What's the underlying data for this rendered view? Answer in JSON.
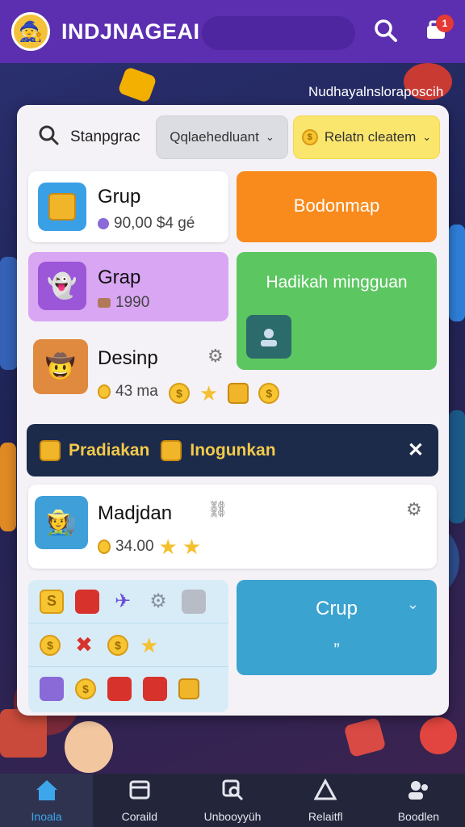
{
  "app": {
    "title": "INDJNAGEAI",
    "notification_count": "1",
    "corner_label": "Nudhayalnsloraposcih"
  },
  "search": {
    "label": "Stanpgrac",
    "dropdown1": "Qqlaehedluant",
    "dropdown2": "Relatn cleatem"
  },
  "tiles": {
    "grup": {
      "name": "Grup",
      "sub": "90,00 $4 gé"
    },
    "orange": {
      "label": "Bodonmap"
    },
    "grap": {
      "name": "Grap",
      "sub": "1990"
    },
    "green": {
      "label": "Hadikah mingguan"
    },
    "desinp": {
      "name": "Desinp",
      "sub": "43 ma"
    },
    "madjdan": {
      "name": "Madjdan",
      "sub": "34.00"
    },
    "crup": {
      "label": "Crup",
      "sub": "”"
    }
  },
  "banner": {
    "item1": "Pradiakan",
    "item2": "Inogunkan"
  },
  "nav": {
    "items": [
      {
        "label": "Inoala",
        "icon": "home-icon"
      },
      {
        "label": "Coraild",
        "icon": "card-icon"
      },
      {
        "label": "Unbooyyüh",
        "icon": "search-card-icon"
      },
      {
        "label": "Relaitfl",
        "icon": "triangle-icon"
      },
      {
        "label": "Boodlen",
        "icon": "people-icon"
      }
    ]
  },
  "colors": {
    "topbar": "#5b2fb0",
    "orange_tile": "#f98a1c",
    "green_tile": "#5cc661",
    "purple_tile": "#d9a6f3",
    "crup_tile": "#3ba3d0",
    "banner": "#1c2b4a",
    "nav_active": "#3da6ea"
  }
}
